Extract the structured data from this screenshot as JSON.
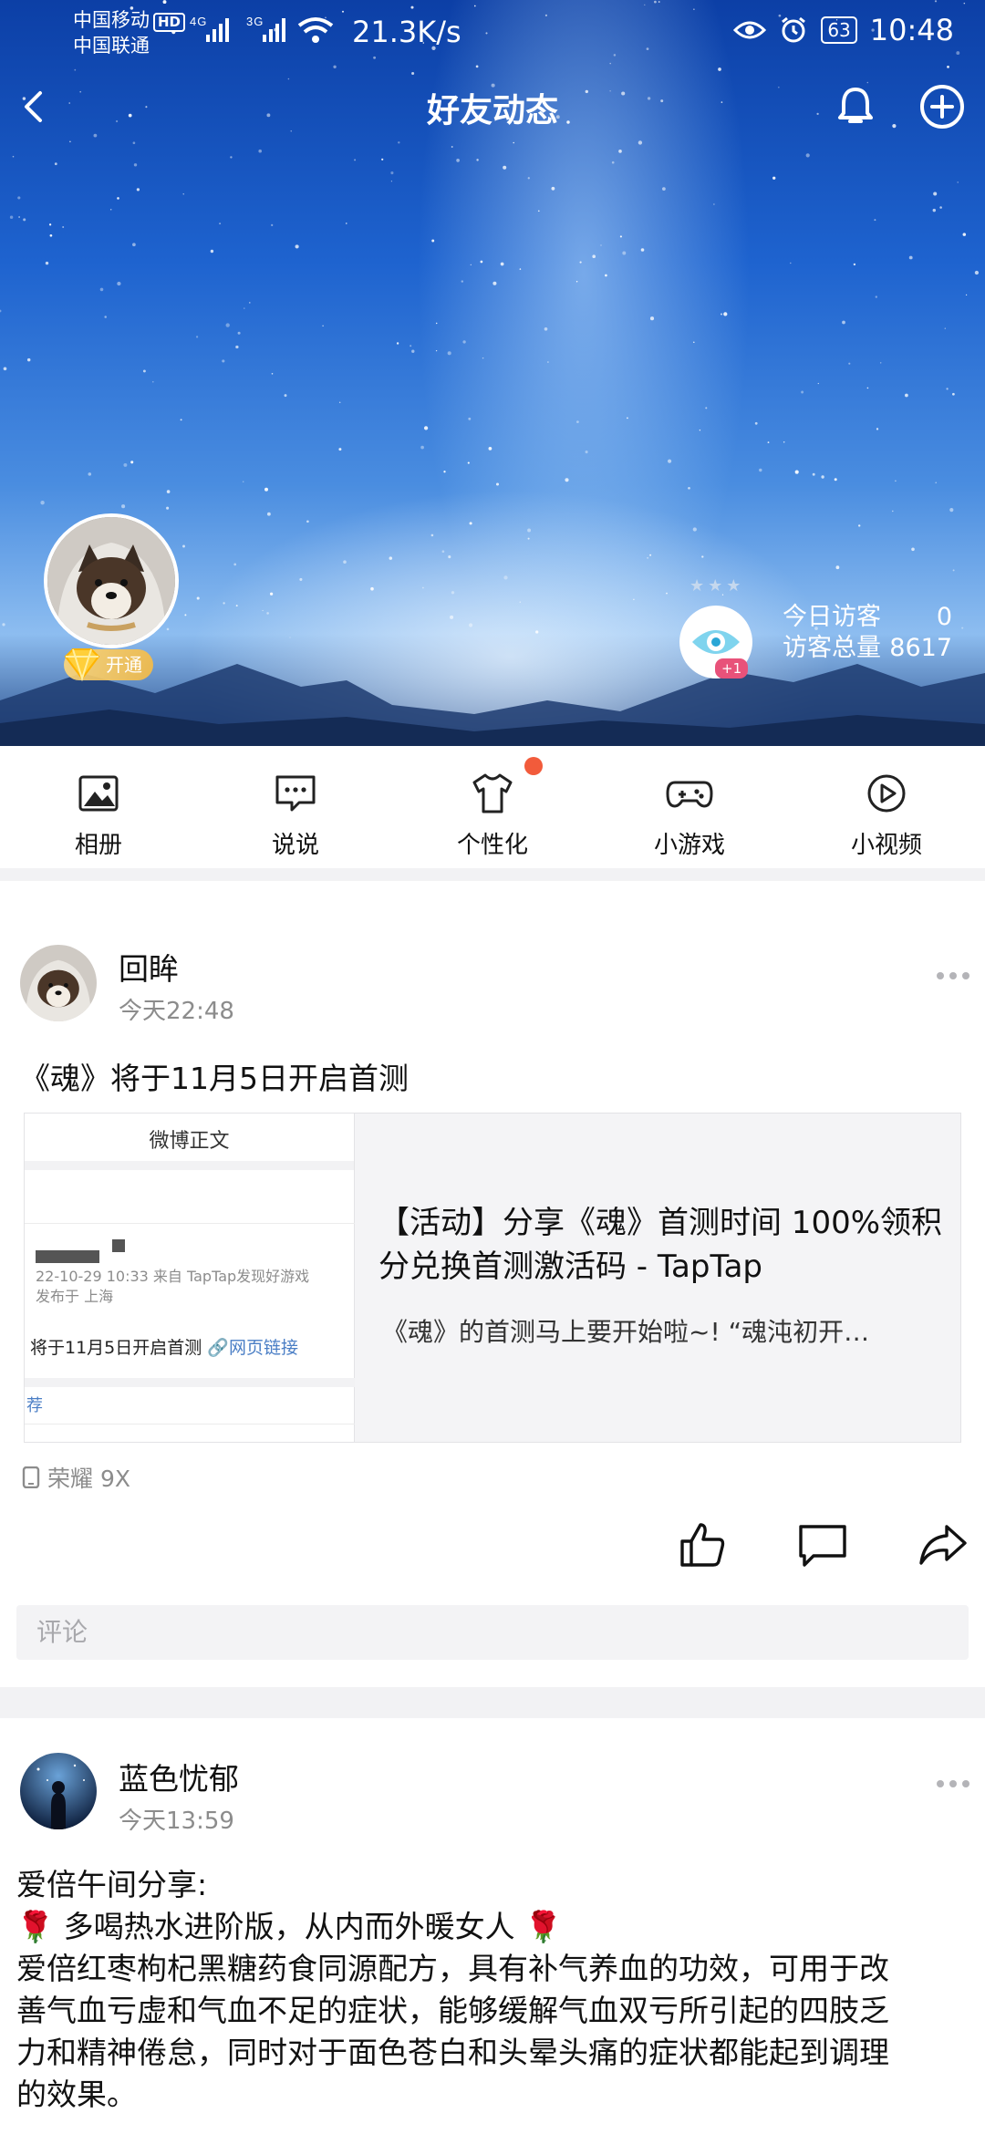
{
  "status_bar": {
    "carrier1": "中国移动",
    "carrier1_badge": "HD",
    "carrier2": "中国联通",
    "signal_label1": "4G",
    "signal_label2": "3G",
    "net_speed": "21.3K/s",
    "battery": "63",
    "time": "10:48"
  },
  "nav": {
    "title": "好友动态",
    "back_icon": "chevron-left-icon",
    "bell_icon": "bell-icon",
    "add_icon": "plus-circle-icon"
  },
  "profile": {
    "vip_label": "开通",
    "eye_badge": "+1",
    "visitors_today_label": "今日访客",
    "visitors_today_value": "0",
    "visitors_total_label": "访客总量",
    "visitors_total_value": "8617"
  },
  "quick_menu": [
    {
      "label": "相册",
      "icon": "photo-icon"
    },
    {
      "label": "说说",
      "icon": "chat-bubble-icon"
    },
    {
      "label": "个性化",
      "icon": "tshirt-icon"
    },
    {
      "label": "小游戏",
      "icon": "gamepad-icon"
    },
    {
      "label": "小视频",
      "icon": "play-circle-icon"
    }
  ],
  "posts": [
    {
      "author": "回眸",
      "time": "今天22:48",
      "text": "《魂》将于11月5日开启首测",
      "link_card": {
        "thumb_header": "微博正文",
        "thumb_meta1": "22-10-29 10:33  来自 TapTap发现好游戏",
        "thumb_meta2": "发布于 上海",
        "thumb_line": "将于11月5日开启首测",
        "thumb_link": "网页链接",
        "thumb_rec": "荐",
        "title": "【活动】分享《魂》首测时间 100%领积分兑换首测激活码 - TapTap",
        "desc": "《魂》的首测马上要开始啦~! “魂沌初开…"
      },
      "device": "荣耀 9X",
      "comment_placeholder": "评论"
    },
    {
      "author": "蓝色忧郁",
      "time": "今天13:59",
      "line1": "爱倍午间分享:",
      "line2": "多喝热水进阶版，从内而外暖女人",
      "line3": "爱倍红枣枸杞黑糖药食同源配方，具有补气养血的功效，可用于改",
      "line4": "善气血亏虚和气血不足的症状，能够缓解气血双亏所引起的四肢乏",
      "line5": "力和精神倦怠，同时对于面色苍白和头晕头痛的症状都能起到调理",
      "line6": "的效果。",
      "emoji": "🌹"
    }
  ],
  "colors": {
    "accent_red": "#f25b3b",
    "link_blue": "#4a7ec5",
    "vip_gold": "#ffc84a"
  }
}
